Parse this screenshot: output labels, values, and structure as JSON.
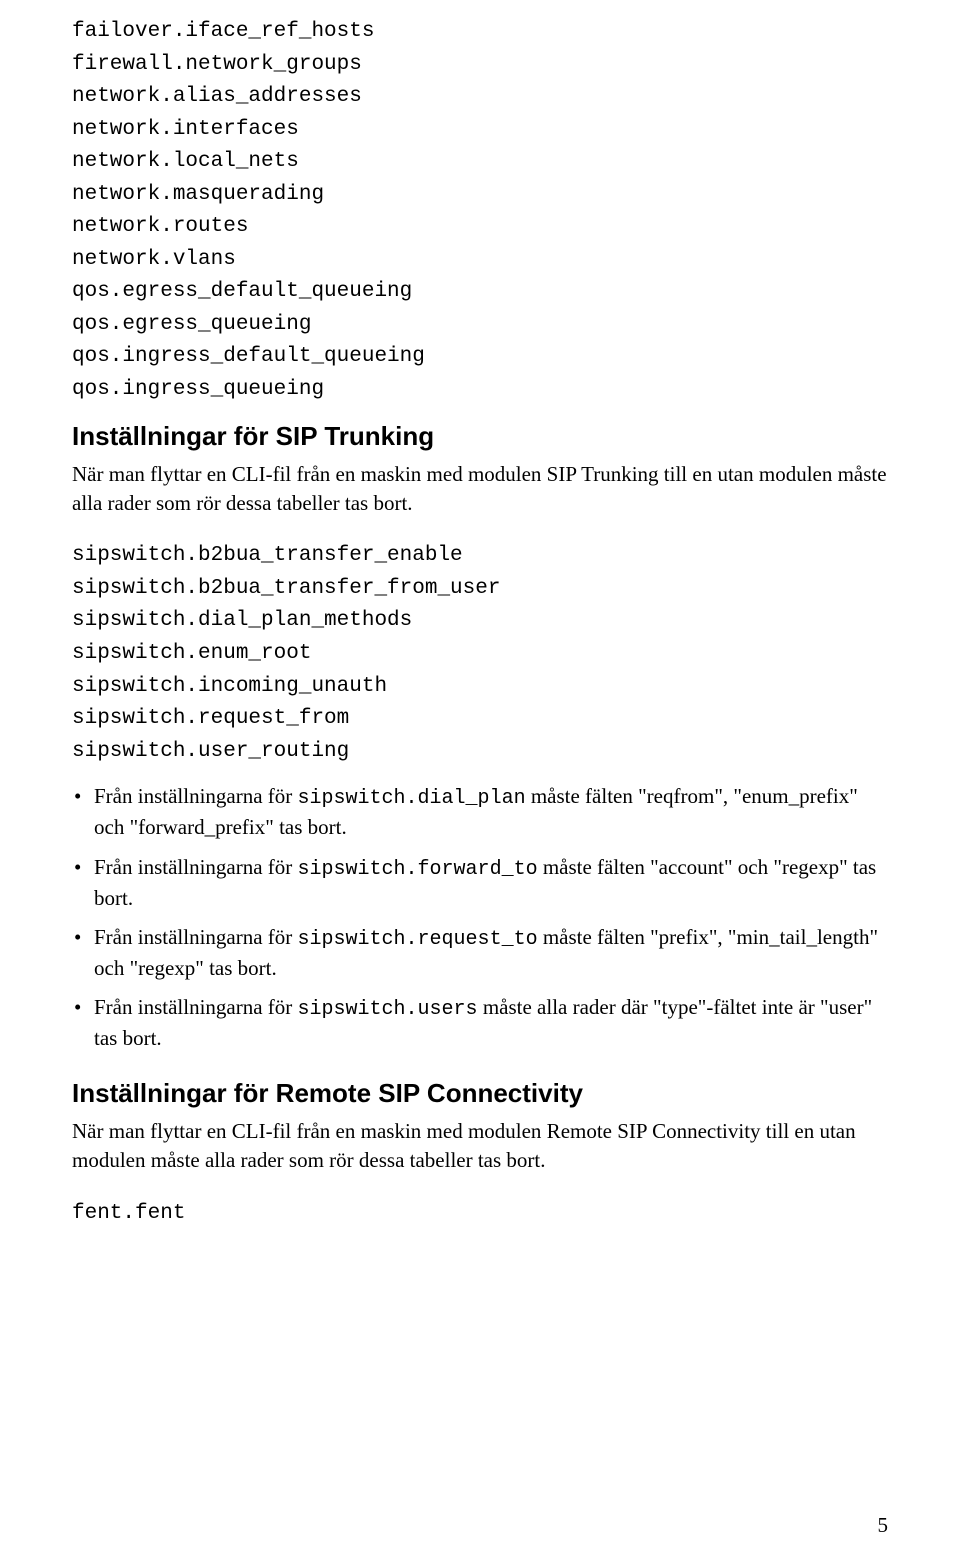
{
  "code_block_1": "failover.iface_ref_hosts\nfirewall.network_groups\nnetwork.alias_addresses\nnetwork.interfaces\nnetwork.local_nets\nnetwork.masquerading\nnetwork.routes\nnetwork.vlans\nqos.egress_default_queueing\nqos.egress_queueing\nqos.ingress_default_queueing\nqos.ingress_queueing",
  "heading_1": "Inställningar för SIP Trunking",
  "para_1": "När man flyttar en CLI-fil från en maskin med modulen SIP Trunking till en utan modulen måste alla rader som rör dessa tabeller tas bort.",
  "code_block_2": "sipswitch.b2bua_transfer_enable\nsipswitch.b2bua_transfer_from_user\nsipswitch.dial_plan_methods\nsipswitch.enum_root\nsipswitch.incoming_unauth\nsipswitch.request_from\nsipswitch.user_routing",
  "bullets": [
    {
      "pre": "Från inställningarna för ",
      "code": "sipswitch.dial_plan",
      "post": " måste fälten \"reqfrom\", \"enum_prefix\" och \"forward_prefix\" tas bort."
    },
    {
      "pre": "Från inställningarna för ",
      "code": "sipswitch.forward_to",
      "post": " måste fälten \"account\" och \"regexp\" tas bort."
    },
    {
      "pre": "Från inställningarna för ",
      "code": "sipswitch.request_to",
      "post": " måste fälten \"prefix\", \"min_tail_length\" och \"regexp\" tas bort."
    },
    {
      "pre": "Från inställningarna för ",
      "code": "sipswitch.users",
      "post": " måste alla rader där \"type\"-fältet inte är \"user\" tas bort."
    }
  ],
  "heading_2": "Inställningar för Remote SIP Connectivity",
  "para_2": "När man flyttar en CLI-fil från en maskin med modulen Remote SIP Connectivity till en utan modulen måste alla rader som rör dessa tabeller tas bort.",
  "code_block_3": "fent.fent",
  "page_number": "5"
}
